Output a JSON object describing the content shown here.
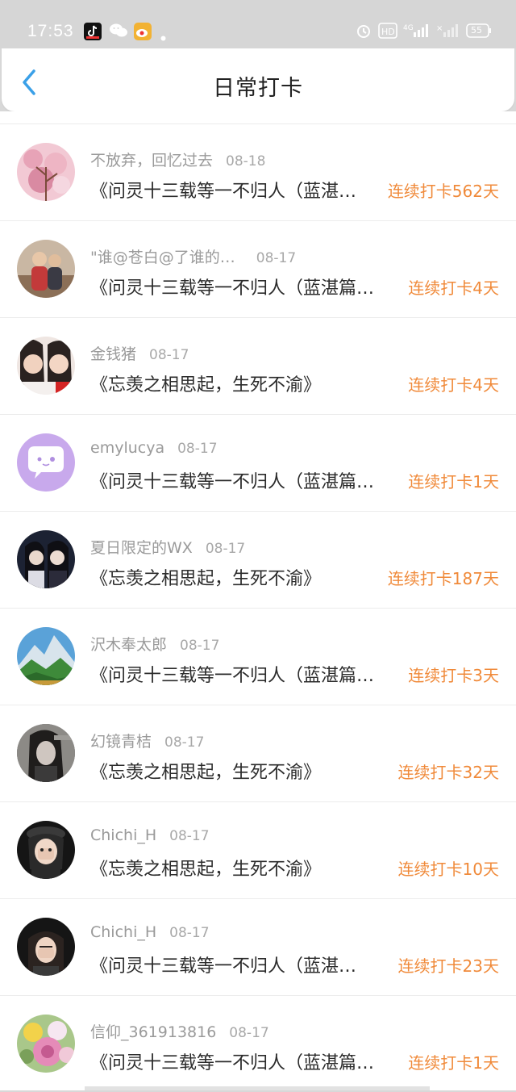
{
  "status_bar": {
    "time": "17:53",
    "battery": "55",
    "icons": [
      "tiktok-icon",
      "wechat-icon",
      "weibo-icon",
      "dot-icon",
      "alarm-icon",
      "hd-icon",
      "signal-4g-icon",
      "wifi-icon",
      "signal-icon",
      "battery-icon"
    ]
  },
  "header": {
    "title": "日常打卡",
    "back_icon": "chevron-left-icon"
  },
  "colors": {
    "accent": "#f08a3a",
    "back_arrow": "#3aa0e8",
    "meta_text": "#9a9a9a"
  },
  "checkins": [
    {
      "user": "不放弃，回忆过去",
      "date": "08-18",
      "work": "《问灵十三载等一不归人（蓝湛…",
      "streak": "连续打卡562天"
    },
    {
      "user": "\"谁@苍白@了谁的…",
      "date": "08-17",
      "work": "《问灵十三载等一不归人（蓝湛篇…",
      "streak": "连续打卡4天"
    },
    {
      "user": "金钱猪",
      "date": "08-17",
      "work": "《忘羡之相思起，生死不渝》",
      "streak": "连续打卡4天"
    },
    {
      "user": "emylucya",
      "date": "08-17",
      "work": "《问灵十三载等一不归人（蓝湛篇…",
      "streak": "连续打卡1天"
    },
    {
      "user": "夏日限定的WX",
      "date": "08-17",
      "work": "《忘羡之相思起，生死不渝》",
      "streak": "连续打卡187天"
    },
    {
      "user": "沢木奉太郎",
      "date": "08-17",
      "work": "《问灵十三载等一不归人（蓝湛篇…",
      "streak": "连续打卡3天"
    },
    {
      "user": "幻镜青桔",
      "date": "08-17",
      "work": "《忘羡之相思起，生死不渝》",
      "streak": "连续打卡32天"
    },
    {
      "user": "Chichi_H",
      "date": "08-17",
      "work": "《忘羡之相思起，生死不渝》",
      "streak": "连续打卡10天"
    },
    {
      "user": "Chichi_H",
      "date": "08-17",
      "work": "《问灵十三载等一不归人（蓝湛…",
      "streak": "连续打卡23天"
    },
    {
      "user": "信仰_361913816",
      "date": "08-17",
      "work": "《问灵十三载等一不归人（蓝湛篇…",
      "streak": "连续打卡1天"
    }
  ]
}
